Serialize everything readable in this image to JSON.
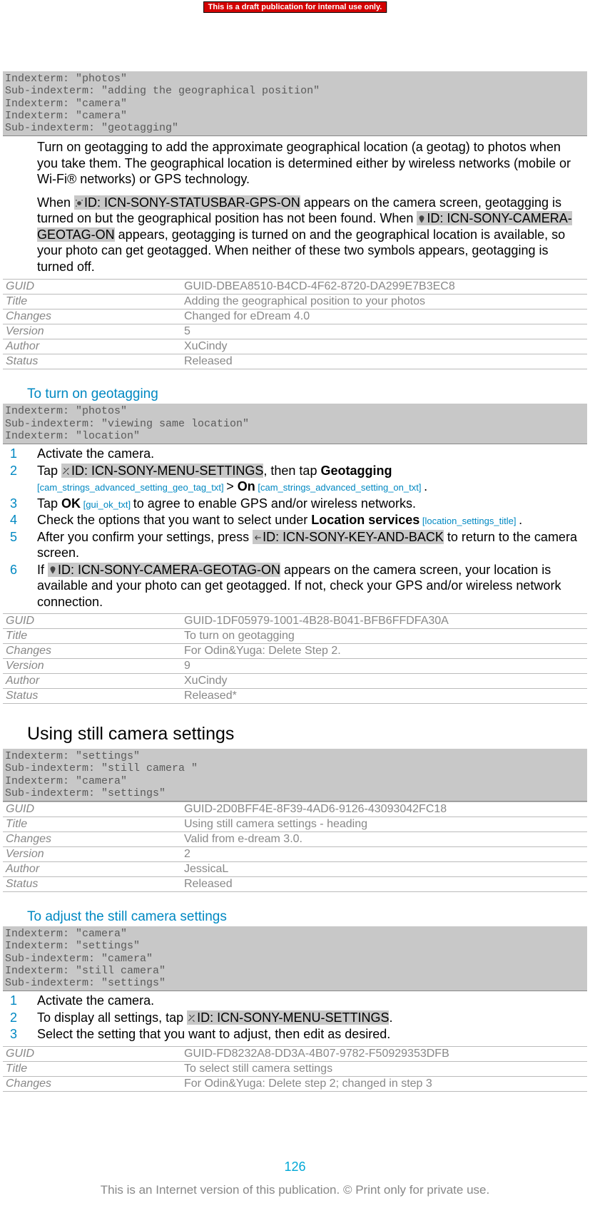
{
  "banner": "This is a draft publication for internal use only.",
  "index1": "Indexterm: \"photos\"\nSub-indexterm: \"adding the geographical position\"\nIndexterm: \"camera\"\nIndexterm: \"camera\"\nSub-indexterm: \"geotagging\"",
  "para1": "Turn on geotagging to add the approximate geographical location (a geotag) to photos when you take them. The geographical location is determined either by wireless networks (mobile or Wi-Fi® networks) or GPS technology.",
  "para2a": "When ",
  "icon_gps_on": "ID: ICN-SONY-STATUSBAR-GPS-ON",
  "para2b": " appears on the camera screen, geotagging is turned on but the geographical position has not been found. When ",
  "icon_geotag_on": "ID: ICN-SONY-CAMERA-GEOTAG-ON",
  "para2c": " appears, geotagging is turned on and the geographical location is available, so your photo can get geotagged. When neither of these two symbols appears, geotagging is turned off.",
  "meta1": {
    "GUID": "GUID-DBEA8510-B4CD-4F62-8720-DA299E7B3EC8",
    "Title": "Adding the geographical position to your photos",
    "Changes": "Changed for eDream 4.0",
    "Version": "5",
    "Author": "XuCindy",
    "Status": "Released"
  },
  "h1": "To turn on geotagging",
  "index2": "Indexterm: \"photos\"\nSub-indexterm: \"viewing same location\"\nIndexterm: \"location\"",
  "steps1": {
    "s1": "Activate the camera.",
    "s2a": "Tap ",
    "icon_menu": "ID: ICN-SONY-MENU-SETTINGS",
    "s2b": ", then tap ",
    "s2_geotagging": "Geotagging",
    "s2_key1": " [cam_strings_advanced_setting_geo_tag_txt] ",
    "s2_gt": "> ",
    "s2_on": "On",
    "s2_key2": " [cam_strings_advanced_setting_on_txt] ",
    "s2_dot": ".",
    "s3a": "Tap ",
    "s3_ok": "OK",
    "s3_key": " [gui_ok_txt] ",
    "s3b": "to agree to enable GPS and/or wireless networks.",
    "s4a": "Check the options that you want to select under ",
    "s4_loc": "Location services",
    "s4_key": " [location_settings_title] ",
    "s4_dot": ".",
    "s5a": "After you confirm your settings, press ",
    "icon_back": "ID: ICN-SONY-KEY-AND-BACK",
    "s5b": " to return to the camera screen.",
    "s6a": "If ",
    "s6b": " appears on the camera screen, your location is available and your photo can get geotagged. If not, check your GPS and/or wireless network connection."
  },
  "meta2": {
    "GUID": "GUID-1DF05979-1001-4B28-B041-BFB6FFDFA30A",
    "Title": "To turn on geotagging",
    "Changes": "For Odin&Yuga: Delete Step 2.",
    "Version": "9",
    "Author": "XuCindy",
    "Status": "Released*"
  },
  "h2": "Using still camera settings",
  "index3": "Indexterm: \"settings\"\nSub-indexterm: \"still camera \"\nIndexterm: \"camera\"\nSub-indexterm: \"settings\"",
  "meta3": {
    "GUID": "GUID-2D0BFF4E-8F39-4AD6-9126-43093042FC18",
    "Title": "Using still camera settings - heading",
    "Changes": "Valid from e-dream 3.0.",
    "Version": "2",
    "Author": "JessicaL",
    "Status": "Released"
  },
  "h3": "To adjust the still camera settings",
  "index4": "Indexterm: \"camera\"\nIndexterm: \"settings\"\nSub-indexterm: \"camera\"\nIndexterm: \"still camera\"\nSub-indexterm: \"settings\"",
  "steps2": {
    "s1": "Activate the camera.",
    "s2a": "To display all settings, tap ",
    "s2b": ".",
    "s3": "Select the setting that you want to adjust, then edit as desired."
  },
  "meta4": {
    "GUID": "GUID-FD8232A8-DD3A-4B07-9782-F50929353DFB",
    "Title": "To select still camera settings",
    "Changes": "For Odin&Yuga: Delete step 2; changed in step 3"
  },
  "labels": {
    "guid": "GUID",
    "title": "Title",
    "changes": "Changes",
    "version": "Version",
    "author": "Author",
    "status": "Status"
  },
  "page_num": "126",
  "footer": "This is an Internet version of this publication. © Print only for private use."
}
